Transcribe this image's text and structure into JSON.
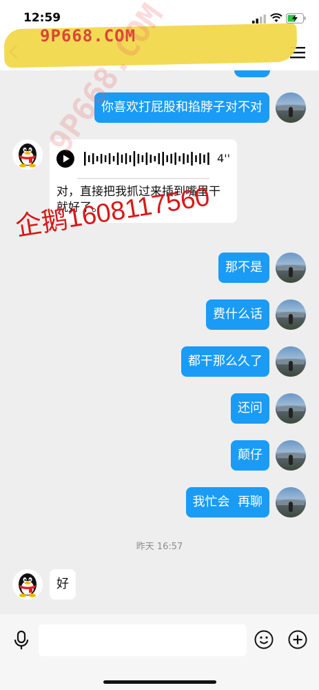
{
  "status_bar": {
    "time": "12:59"
  },
  "watermark": {
    "banner": "9P668.COM",
    "diagonal": "9P668.COM",
    "red_text": "企鹅1608117560"
  },
  "messages": [
    {
      "side": "out",
      "text": "你喜欢打屁股和掐脖子对不对"
    },
    {
      "side": "in",
      "type": "voice",
      "duration": "4''",
      "transcript": "对，直接把我抓过来插到嘴里干就好了。"
    },
    {
      "side": "out",
      "text": "那不是"
    },
    {
      "side": "out",
      "text": "费什么话"
    },
    {
      "side": "out",
      "text": "都干那么久了"
    },
    {
      "side": "out",
      "text": "还问"
    },
    {
      "side": "out",
      "text": "颠仔"
    },
    {
      "side": "out",
      "text": "我忙会  再聊"
    },
    {
      "type": "timestamp",
      "text": "昨天 16:57"
    },
    {
      "side": "in",
      "text": "好"
    }
  ],
  "input": {
    "value": "",
    "placeholder": ""
  },
  "colors": {
    "accent": "#1a9bf5",
    "background": "#eeeeee"
  }
}
